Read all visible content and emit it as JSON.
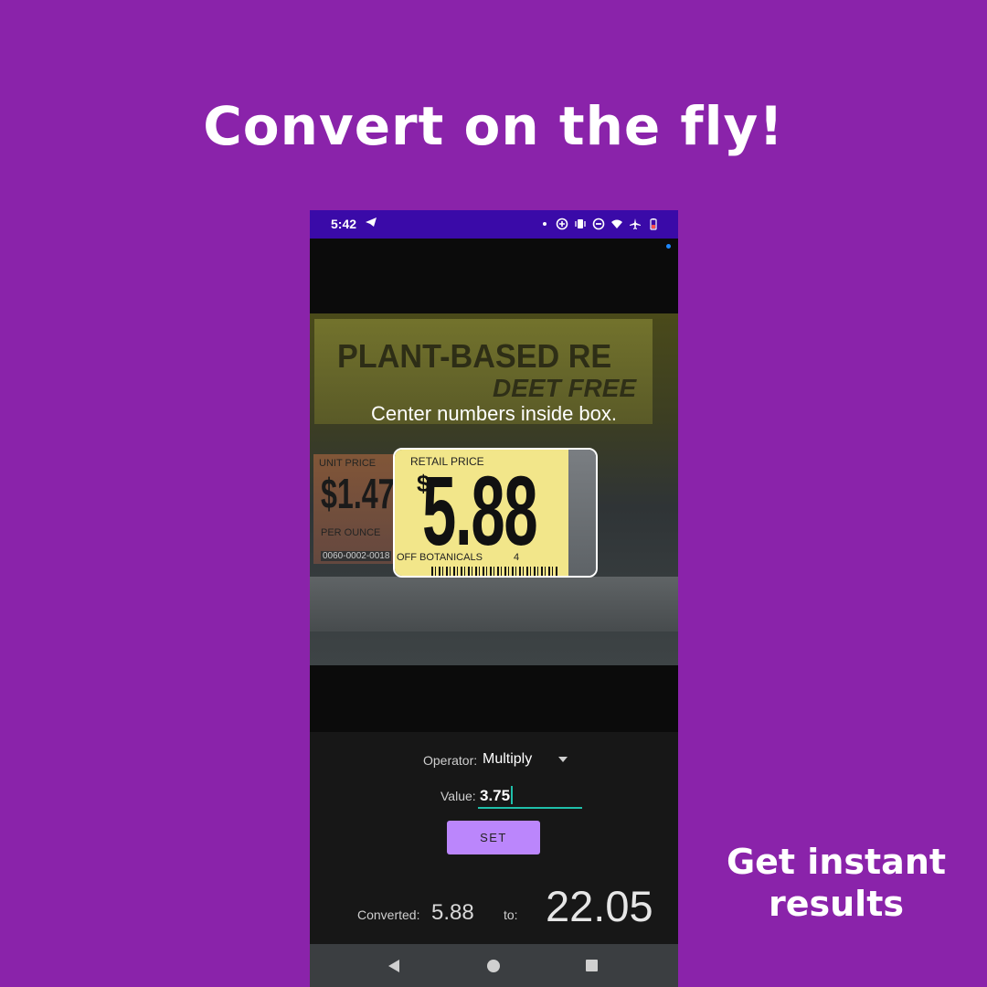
{
  "headline": "Convert on the fly!",
  "tagline": "Get instant results",
  "status_bar": {
    "time": "5:42",
    "icons": [
      "telegram-icon",
      "dot-icon",
      "data-saver-icon",
      "vibrate-icon",
      "do-not-disturb-icon",
      "wifi-icon",
      "airplane-icon",
      "battery-low-icon"
    ]
  },
  "camera": {
    "instruction": "Center numbers inside box.",
    "shelf_text_1": "PLANT-BASED RE",
    "shelf_text_2": "DEET FREE",
    "unit_tag": {
      "label": "UNIT PRICE",
      "price": "$1.47",
      "unit": "PER OUNCE",
      "code": "0060-0002-0018"
    },
    "price_tag": {
      "label": "RETAIL PRICE",
      "currency": "$",
      "amount": "5.88",
      "footer": "OFF BOTANICALS",
      "footer_num": "4"
    }
  },
  "controls": {
    "operator_label": "Operator:",
    "operator_value": "Multiply",
    "value_label": "Value:",
    "value": "3.75",
    "set_button": "SET",
    "converted_label": "Converted:",
    "converted_value": "5.88",
    "to_label": "to:",
    "result": "22.05"
  },
  "colors": {
    "background": "#8a23aa",
    "status_bar": "#3a0aa8",
    "accent": "#bb86fc",
    "input_underline": "#1fbfaa"
  }
}
